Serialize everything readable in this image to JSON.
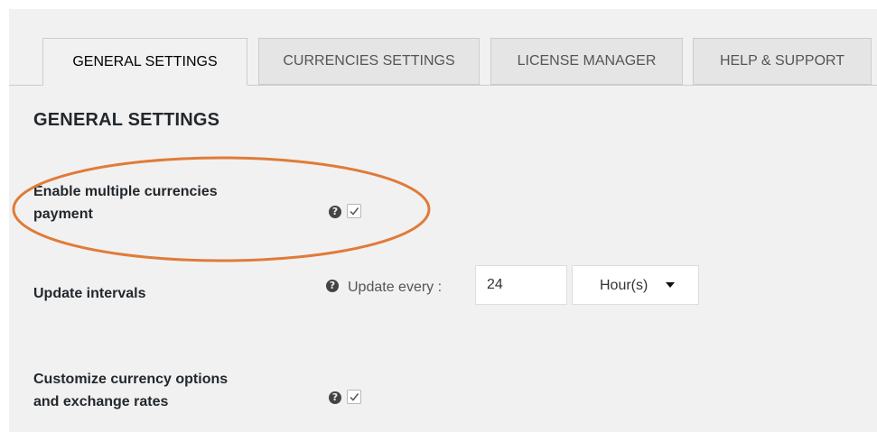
{
  "tabs": [
    {
      "label": "GENERAL SETTINGS",
      "active": true
    },
    {
      "label": "CURRENCIES SETTINGS",
      "active": false
    },
    {
      "label": "LICENSE MANAGER",
      "active": false
    },
    {
      "label": "HELP & SUPPORT",
      "active": false
    }
  ],
  "section": {
    "title": "GENERAL SETTINGS"
  },
  "settings": {
    "multi_currency": {
      "label_line1": "Enable multiple currencies",
      "label_line2": "payment",
      "help_icon": "question-circle-icon",
      "checked": true
    },
    "update_interval": {
      "label": "Update intervals",
      "help_icon": "question-circle-icon",
      "prefix_text": "Update every :",
      "value": "24",
      "unit_selected": "Hour(s)"
    },
    "customize_options": {
      "label_line1": "Customize currency options",
      "label_line2": "and exchange rates",
      "help_icon": "question-circle-icon",
      "checked": true
    }
  },
  "colors": {
    "panel_bg": "#f1f1f1",
    "highlight": "#e07b39"
  }
}
